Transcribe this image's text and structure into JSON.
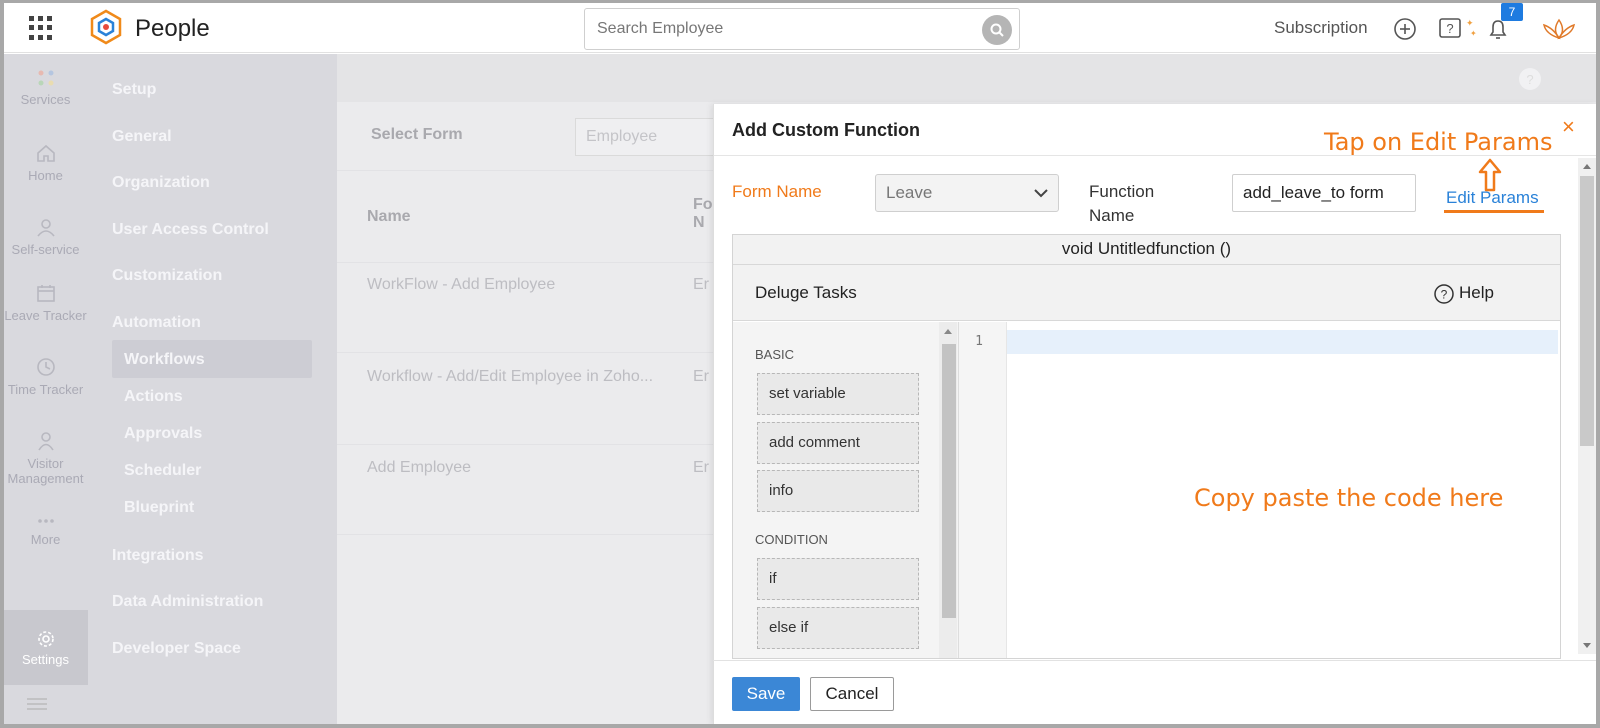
{
  "app": {
    "name": "People"
  },
  "search": {
    "placeholder": "Search Employee"
  },
  "topbar": {
    "subscription": "Subscription",
    "notification_count": "7"
  },
  "rail": {
    "items": [
      {
        "label": "Services",
        "icon": "services-icon"
      },
      {
        "label": "Home",
        "icon": "home-icon"
      },
      {
        "label": "Self-service",
        "icon": "user-icon"
      },
      {
        "label": "Leave Tracker",
        "icon": "calendar-icon"
      },
      {
        "label": "Time Tracker",
        "icon": "clock-icon"
      },
      {
        "label": "Visitor Management",
        "icon": "visitor-icon"
      },
      {
        "label": "More",
        "icon": "more-icon"
      },
      {
        "label": "Settings",
        "icon": "gear-icon"
      }
    ]
  },
  "setup_nav": {
    "heading": "Setup",
    "items": [
      "General",
      "Organization",
      "User Access Control",
      "Customization",
      "Automation"
    ],
    "automation_sub": [
      "Workflows",
      "Actions",
      "Approvals",
      "Scheduler",
      "Blueprint"
    ],
    "items_after": [
      "Integrations",
      "Data Administration",
      "Developer Space"
    ]
  },
  "background": {
    "select_form_label": "Select Form",
    "select_form_value": "Employee",
    "col_name": "Name",
    "col_fo_line1": "Fo",
    "col_fo_line2": "N",
    "rows": [
      {
        "name": "WorkFlow - Add Employee",
        "form": "Er"
      },
      {
        "name": "Workflow - Add/Edit Employee in Zoho...",
        "form": "Er"
      },
      {
        "name": "Add Employee",
        "form": "Er"
      }
    ]
  },
  "panel": {
    "title": "Add Custom Function",
    "close": "×",
    "form_name_label": "Form Name",
    "form_name_value": "Leave",
    "function_name_label": "Function Name",
    "function_name_value": "add_leave_to form",
    "edit_params": "Edit Params",
    "signature": "void Untitledfunction ()",
    "deluge_tasks": "Deluge Tasks",
    "help": "Help",
    "categories": [
      {
        "name": "BASIC",
        "tasks": [
          "set variable",
          "add comment",
          "info"
        ]
      },
      {
        "name": "CONDITION",
        "tasks": [
          "if",
          "else if"
        ]
      }
    ],
    "line_number": "1",
    "save": "Save",
    "cancel": "Cancel"
  },
  "annotations": {
    "edit_params_hint": "Tap on Edit Params",
    "copy_hint": "Copy paste the code here"
  },
  "colors": {
    "accent_orange": "#f07a1a",
    "link_blue": "#2a82d8",
    "save_blue": "#3b87d6"
  }
}
